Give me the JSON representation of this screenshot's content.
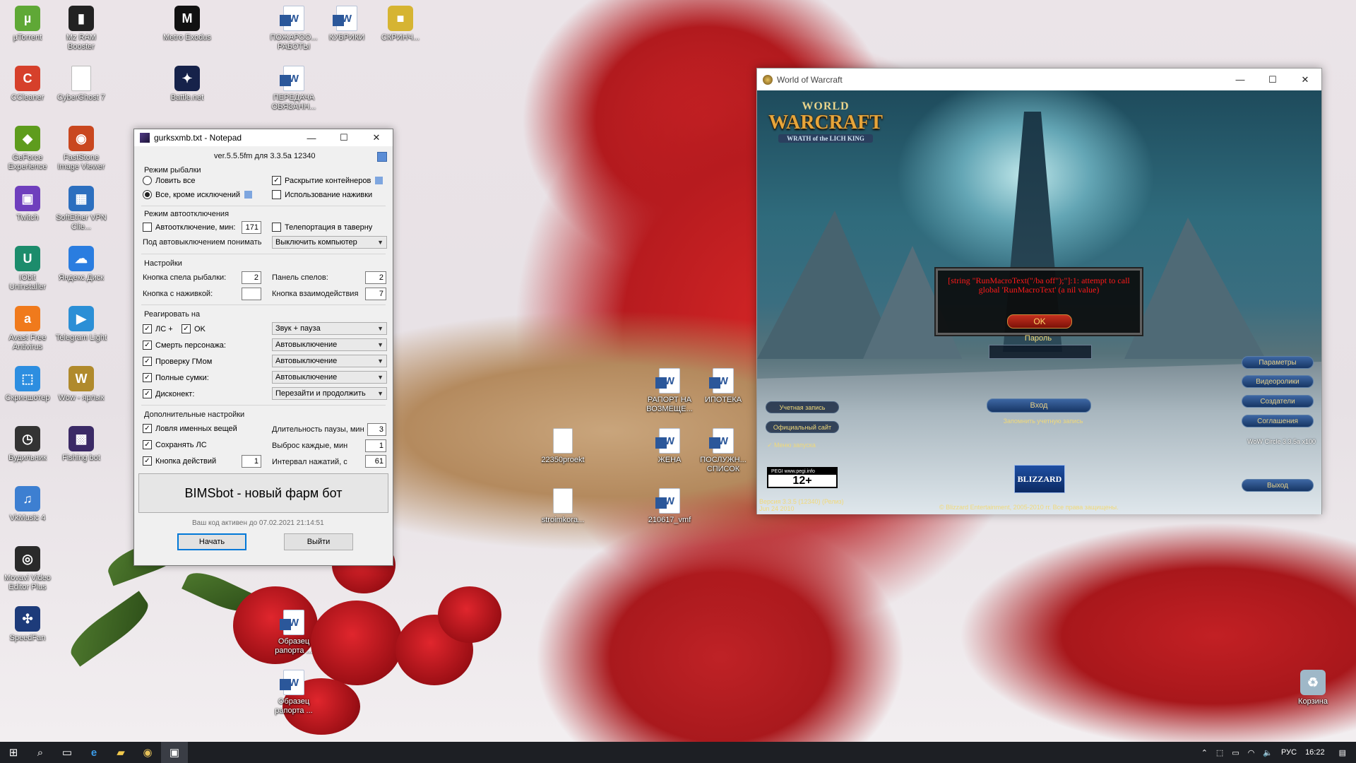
{
  "desktop": {
    "icons": [
      {
        "label": "µTorrent",
        "color": "#5fa836",
        "glyph": "µ"
      },
      {
        "label": "Mz RAM Booster",
        "color": "#222222",
        "glyph": "▮"
      },
      {
        "label": "Metro Exodus",
        "color": "#111111",
        "glyph": "M"
      },
      {
        "label": "ПОЖАРОО... РАБОТЫ",
        "color": "word",
        "glyph": "W"
      },
      {
        "label": "КУБРИКИ",
        "color": "word",
        "glyph": "W"
      },
      {
        "label": "СКРИНЧ...",
        "color": "#d6b432",
        "glyph": "■"
      },
      {
        "label": "CCleaner",
        "color": "#d6402b",
        "glyph": "C"
      },
      {
        "label": "CyberGhost 7",
        "color": "doc",
        "glyph": ""
      },
      {
        "label": "Battle.net",
        "color": "#16224a",
        "glyph": "✦"
      },
      {
        "label": "ПЕРЕДАЧА ОБЯЗАНН...",
        "color": "word",
        "glyph": "W"
      },
      {
        "label": "GeForce Experience",
        "color": "#5e9c1d",
        "glyph": "◆"
      },
      {
        "label": "FastStone Image Viewer",
        "color": "#c9471f",
        "glyph": "◉"
      },
      {
        "label": "Twitch",
        "color": "#6f3fbd",
        "glyph": "▣"
      },
      {
        "label": "SoftEther VPN Clie...",
        "color": "#2c6fbf",
        "glyph": "▦"
      },
      {
        "label": "IObit Uninstaller",
        "color": "#1c8c6c",
        "glyph": "U"
      },
      {
        "label": "Яндекс.Диск",
        "color": "#2a7de0",
        "glyph": "☁"
      },
      {
        "label": "Avast Free Antivirus",
        "color": "#f07a1c",
        "glyph": "a"
      },
      {
        "label": "Telegram Light",
        "color": "#2b8fd6",
        "glyph": "▶"
      },
      {
        "label": "Скриншотер",
        "color": "#2d8ee0",
        "glyph": "⬚"
      },
      {
        "label": "Wow - ярлык",
        "color": "#b08a2c",
        "glyph": "W"
      },
      {
        "label": "Будильник",
        "color": "#333333",
        "glyph": "◷"
      },
      {
        "label": "Fishing bot",
        "color": "#3b2a66",
        "glyph": "▩"
      },
      {
        "label": "VkMusic 4",
        "color": "#3d7fd1",
        "glyph": "♫"
      },
      {
        "label": "Movavi Video Editor Plus",
        "color": "#2a2a2a",
        "glyph": "◎"
      },
      {
        "label": "SpeedFan",
        "color": "#1d3b7a",
        "glyph": "✣"
      },
      {
        "label": "РАПОРТ НА ВОЗМЕЩЕ...",
        "color": "word",
        "glyph": "W"
      },
      {
        "label": "ИПОТЕКА",
        "color": "word",
        "glyph": "W"
      },
      {
        "label": "22350proekt",
        "color": "doc",
        "glyph": ""
      },
      {
        "label": "ЖЕНА",
        "color": "word",
        "glyph": "W"
      },
      {
        "label": "ПОСЛУЖН... СПИСОК",
        "color": "word",
        "glyph": "W"
      },
      {
        "label": "stroimkora...",
        "color": "doc",
        "glyph": ""
      },
      {
        "label": "210617_vmf",
        "color": "word",
        "glyph": "W"
      },
      {
        "label": "Образец рапорта ...",
        "color": "word",
        "glyph": "W"
      },
      {
        "label": "Образец рапорта ...",
        "color": "word",
        "glyph": "W"
      },
      {
        "label": "Корзина",
        "color": "#9fb8c8",
        "glyph": "♻"
      }
    ]
  },
  "bot": {
    "title": "gurksxmb.txt - Notepad",
    "version": "ver.5.5.5fm для 3.3.5a 12340",
    "fishing_mode": {
      "heading": "Режим рыбалки",
      "opt_all": "Ловить все",
      "opt_except": "Все, кроме исключений",
      "open_containers": "Раскрытие контейнеров",
      "use_bait": "Использование наживки"
    },
    "auto_off": {
      "heading": "Режим автоотключения",
      "auto_off_min": "Автоотключение, мин:",
      "auto_off_value": "171",
      "teleport": "Телепортация в таверну",
      "under_label": "Под автовыключением понимать",
      "under_value": "Выключить компьютер"
    },
    "settings": {
      "heading": "Настройки",
      "spell_button": "Кнопка спела рыбалки:",
      "spell_button_value": "2",
      "spell_panel": "Панель спелов:",
      "spell_panel_value": "2",
      "bait_button": "Кнопка с наживкой:",
      "bait_button_value": "",
      "interact_button": "Кнопка взаимодействия",
      "interact_button_value": "7"
    },
    "react": {
      "heading": "Реагировать на",
      "pm": "ЛС +",
      "ok": "OK",
      "pm_action": "Звук + пауза",
      "death": "Смерть персонажа:",
      "death_action": "Автовыключение",
      "gm": "Проверку ГМом",
      "gm_action": "Автовыключение",
      "bags": "Полные сумки:",
      "bags_action": "Автовыключение",
      "disconnect": "Дисконект:",
      "disconnect_action": "Перезайти и продолжить"
    },
    "extra": {
      "heading": "Дополнительные настройки",
      "named": "Ловля именных вещей",
      "pause_len": "Длительность паузы, мин",
      "pause_len_value": "3",
      "save_pm": "Сохранять ЛС",
      "throw_every": "Выброс каждые, мин",
      "throw_every_value": "1",
      "action_button": "Кнопка действий",
      "action_button_value": "1",
      "press_interval": "Интервал нажатий, с",
      "press_interval_value": "61"
    },
    "banner": "BIMSbot - новый фарм бот",
    "license": "Ваш код активен до 07.02.2021 21:14:51",
    "start": "Начать",
    "exit": "Выйти"
  },
  "wow": {
    "title": "World of Warcraft",
    "logo_top": "WORLD",
    "logo_main": "WARCRAFT",
    "logo_sub": "WRATH of the LICH KING",
    "error_text": "[string \"RunMacroText(\"/ba off\");\"]:1: attempt to call global 'RunMacroText' (a nil value)",
    "ok": "OK",
    "password_label": "Пароль",
    "login": "Вход",
    "remember": "Запомнить учетную запись",
    "account": "Учетная запись",
    "site": "Официальный сайт",
    "launch_menu": "Меню запуска",
    "right_buttons": [
      "Параметры",
      "Видеоролики",
      "Создатели",
      "Соглашения"
    ],
    "realm": "WoW Circle 3.3.5a x100",
    "exit": "Выход",
    "pegi_site": "PEGI www.pegi.info",
    "pegi_rating": "12+",
    "version": "Версия 3.3.5 (12340) (Релиз)",
    "date": "Jun 24 2010",
    "copyright": "© Blizzard Entertainment, 2005-2010 гг. Все права защищены.",
    "blizzard": "BLIZZARD"
  },
  "taskbar": {
    "lang": "РУС",
    "time": "16:22"
  }
}
